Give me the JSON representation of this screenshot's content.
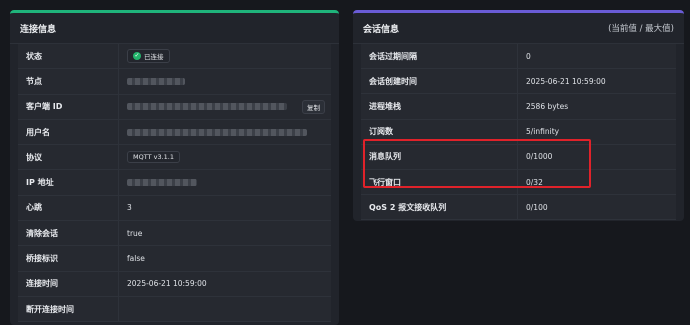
{
  "connection": {
    "title": "连接信息",
    "rows": [
      {
        "label": "状态",
        "value": "已连接"
      },
      {
        "label": "节点",
        "value": ""
      },
      {
        "label": "客户端 ID",
        "value": "",
        "action": "复制"
      },
      {
        "label": "用户名",
        "value": ""
      },
      {
        "label": "协议",
        "value": "MQTT v3.1.1"
      },
      {
        "label": "IP 地址",
        "value": ""
      },
      {
        "label": "心跳",
        "value": "3"
      },
      {
        "label": "清除会话",
        "value": "true"
      },
      {
        "label": "桥接标识",
        "value": "false"
      },
      {
        "label": "连接时间",
        "value": "2025-06-21 10:59:00"
      },
      {
        "label": "断开连接时间",
        "value": ""
      }
    ]
  },
  "session": {
    "title": "会话信息",
    "hint": "(当前值 / 最大值)",
    "rows": [
      {
        "label": "会话过期间隔",
        "value": "0"
      },
      {
        "label": "会话创建时间",
        "value": "2025-06-21 10:59:00"
      },
      {
        "label": "进程堆栈",
        "value": "2586 bytes"
      },
      {
        "label": "订阅数",
        "value": "5/infinity"
      },
      {
        "label": "消息队列",
        "value": "0/1000"
      },
      {
        "label": "飞行窗口",
        "value": "0/32"
      },
      {
        "label": "QoS 2 报文接收队列",
        "value": "0/100"
      }
    ]
  },
  "colors": {
    "accent_left": "#1fb47b",
    "accent_right": "#6a5cd6",
    "highlight": "#e0222a",
    "status_ok": "#22b36b"
  },
  "icons": {
    "status": "check-circle-icon"
  }
}
